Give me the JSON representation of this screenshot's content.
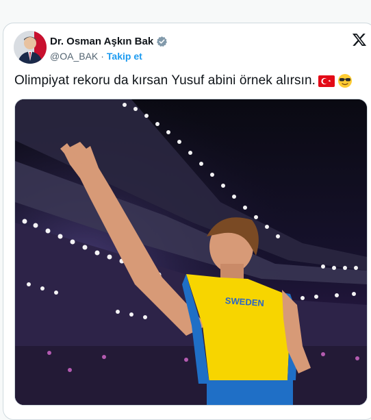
{
  "author": {
    "display_name": "Dr. Osman Aşkın Bak",
    "handle": "@OA_BAK",
    "separator": "·",
    "follow_label": "Takip et",
    "verified_color": "#829aab",
    "avatar_icon": "profile-photo"
  },
  "tweet": {
    "text": "Olimpiyat rekoru da kırsan Yusuf abini örnek alırsın.",
    "emojis": [
      "turkey-flag",
      "sunglasses-face"
    ],
    "smiley": "😎"
  },
  "media": {
    "jersey_text": "SWEDEN",
    "description_icon": "athlete-photo"
  },
  "colors": {
    "link": "#1d9bf0",
    "text": "#0f1419",
    "muted": "#536471",
    "border": "#cfd9de",
    "jersey_yellow": "#f7d500",
    "jersey_blue": "#1f6fc6"
  },
  "app": {
    "logo_icon": "x-logo"
  }
}
